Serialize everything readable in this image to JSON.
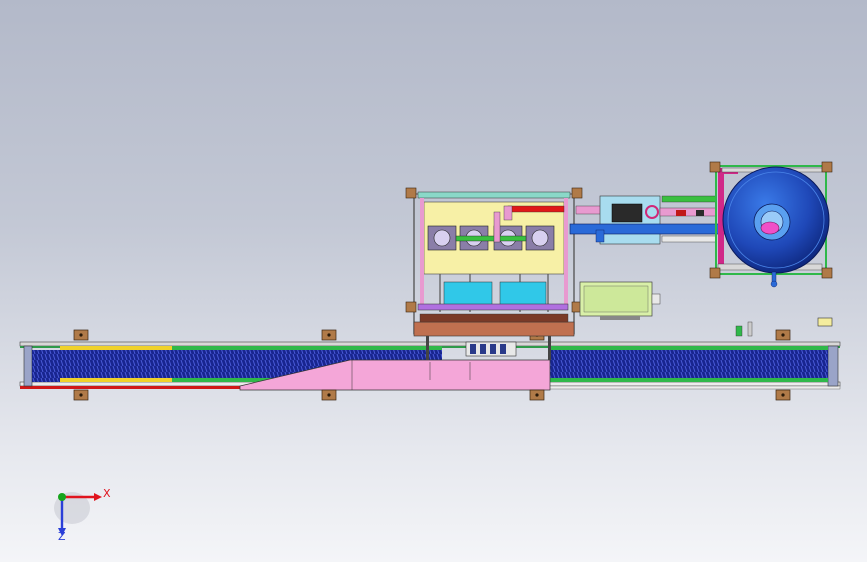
{
  "triad": {
    "x_label": "X",
    "z_label": "Z",
    "x_color": "#e0141e",
    "y_color": "#16a51c",
    "z_color": "#2a3fd8"
  },
  "colors": {
    "frame": "#f4ed9e",
    "pink_panel": "#f4a6d8",
    "conveyor_blue": "#1c2a9e",
    "tank": "#2356c8",
    "control_box": "#d9f0a8",
    "rail_red": "#d01818"
  }
}
